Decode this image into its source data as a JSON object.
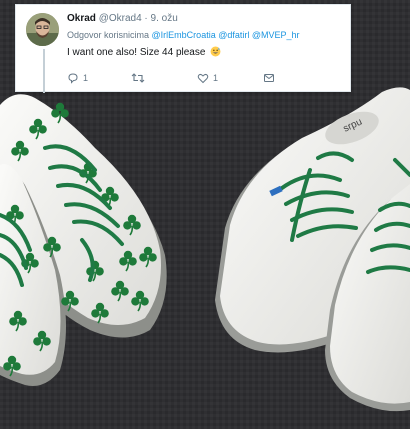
{
  "tweet": {
    "display_name": "Okrad",
    "handle": "@Okrad4",
    "separator": "·",
    "date": "9. ožu",
    "reply_prefix": "Odgovor korisnicima",
    "mentions": [
      "@IrlEmbCroatia",
      "@dfatirl",
      "@MVEP_hr"
    ],
    "text": "I want one also! Size 44 please",
    "emoji": "grinning-sweat-emoji",
    "actions": {
      "reply": {
        "icon": "reply-icon",
        "count": "1"
      },
      "retweet": {
        "icon": "retweet-icon",
        "count": ""
      },
      "like": {
        "icon": "heart-icon",
        "count": "1"
      },
      "message": {
        "icon": "envelope-icon",
        "count": ""
      }
    }
  },
  "photo": {
    "subject": "pairs of white canvas sneakers with green laces, left pair printed with green shamrocks",
    "colors": {
      "background": "#2f2f32",
      "canvas": "#f3f3f1",
      "shamrock": "#1e7a3a",
      "lace": "#1f7a45",
      "mention_link": "#1b95e0"
    }
  }
}
